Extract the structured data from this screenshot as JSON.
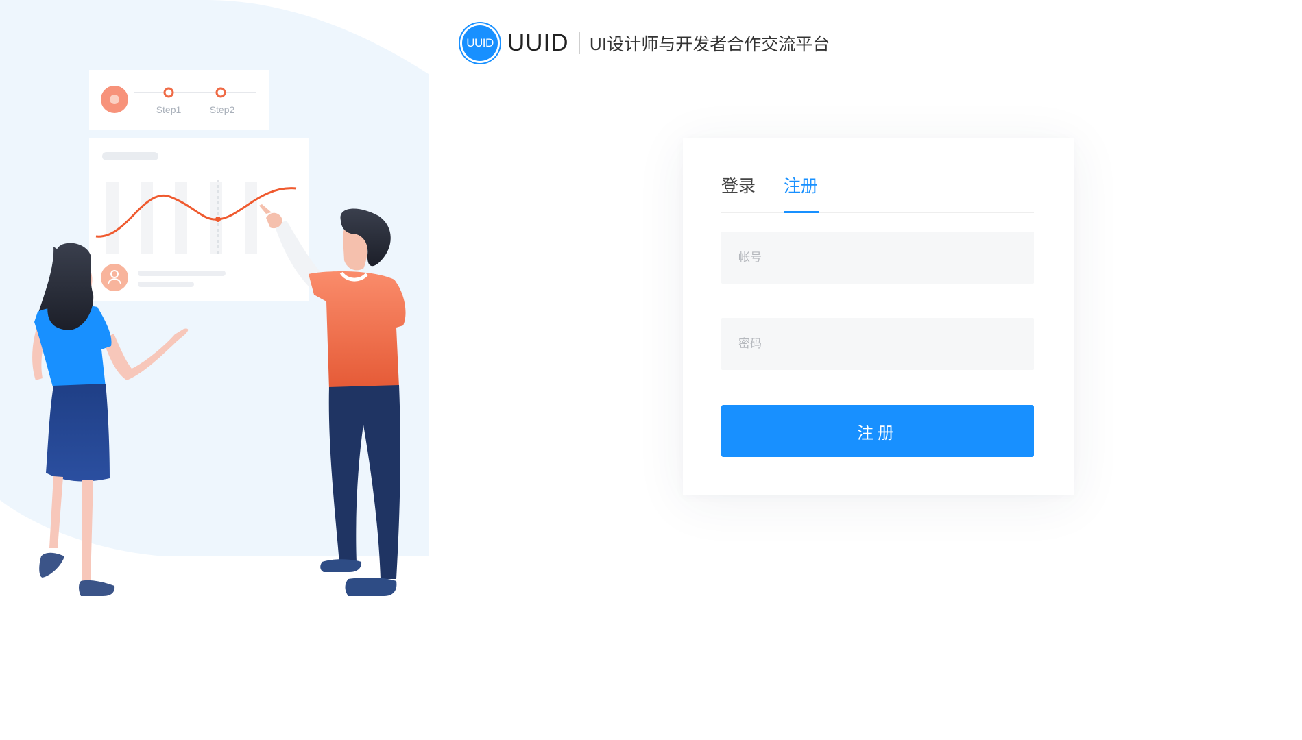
{
  "header": {
    "logo_badge": "UUID",
    "logo_name": "UUID",
    "slogan": "UI设计师与开发者合作交流平台"
  },
  "illustration": {
    "steps": [
      "Step1",
      "Step2"
    ]
  },
  "auth_card": {
    "tabs": [
      {
        "label": "登录",
        "active": false
      },
      {
        "label": "注册",
        "active": true
      }
    ],
    "account_placeholder": "帐号",
    "account_value": "",
    "password_placeholder": "密码",
    "password_value": "",
    "submit_label": "注册"
  },
  "colors": {
    "primary": "#1890ff",
    "input_bg": "#f6f7f8",
    "illustration_bg": "#eef6fd",
    "accent_orange": "#f07a55",
    "navy": "#243a6b"
  }
}
